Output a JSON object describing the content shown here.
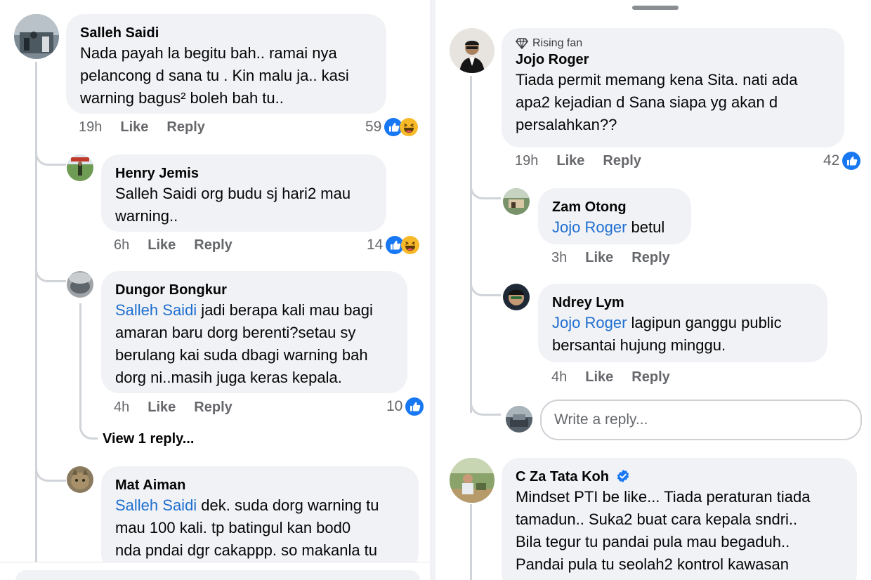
{
  "left": {
    "comments": [
      {
        "name": "Salleh Saidi",
        "lines": [
          "Nada payah la begitu bah.. ramai nya",
          "pelancong d sana tu . Kin malu ja.. kasi",
          "warning bagus² boleh bah tu.."
        ],
        "time": "19h",
        "like": "Like",
        "reply": "Reply",
        "reactions": "59",
        "reaction_icons": [
          "like-reaction-icon",
          "haha-reaction-icon"
        ]
      },
      {
        "name": "Henry Jemis",
        "lines": [
          "Salleh Saidi org budu sj hari2 mau",
          "warning.."
        ],
        "time": "6h",
        "like": "Like",
        "reply": "Reply",
        "reactions": "14",
        "reaction_icons": [
          "like-reaction-icon",
          "haha-reaction-icon"
        ]
      },
      {
        "name": "Dungor Bongkur",
        "mention": "Salleh Saidi",
        "first_rest": " jadi berapa kali mau bagi",
        "lines": [
          "amaran baru dorg berenti?setau sy",
          "berulang kai suda dbagi warning bah",
          "dorg ni..masih juga keras kepala."
        ],
        "time": "4h",
        "like": "Like",
        "reply": "Reply",
        "reactions": "10",
        "reaction_icons": [
          "like-reaction-icon"
        ],
        "view_replies": "View 1 reply..."
      },
      {
        "name": "Mat Aiman",
        "mention": "Salleh Saidi",
        "first_rest": " dek. suda dorg warning tu",
        "lines": [
          "mau 100 kali. tp batingul kan bod0",
          "nda pndai dgr cakappp. so makanla tu"
        ]
      }
    ]
  },
  "right": {
    "comments": [
      {
        "badge": "Rising fan",
        "name": "Jojo Roger",
        "lines": [
          "Tiada permit memang kena Sita. nati ada",
          "apa2 kejadian d Sana siapa yg akan d",
          "persalahkan??"
        ],
        "time": "19h",
        "like": "Like",
        "reply": "Reply",
        "reactions": "42",
        "reaction_icons": [
          "like-reaction-icon"
        ]
      },
      {
        "name": "Zam Otong",
        "mention": "Jojo Roger",
        "first_rest": " betul",
        "time": "3h",
        "like": "Like",
        "reply": "Reply"
      },
      {
        "name": "Ndrey Lym",
        "mention": "Jojo Roger",
        "first_rest": "  lagipun ganggu public",
        "lines": [
          "bersantai hujung minggu."
        ],
        "time": "4h",
        "like": "Like",
        "reply": "Reply"
      },
      {
        "name": "C Za Tata Koh",
        "verified": true,
        "lines": [
          "Mindset PTI be like... Tiada peraturan tiada",
          "tamadun.. Suka2 buat cara kepala sndri..",
          "Bila tegur tu pandai pula mau begaduh..",
          "Pandai pula tu seolah2 kontrol kawasan"
        ]
      }
    ],
    "write_reply_placeholder": "Write a reply..."
  },
  "colors": {
    "bubble": "#f0f2f5",
    "mention": "#1f6fd1",
    "meta": "#65676b",
    "like_blue": "#1877f2",
    "haha_yellow": "#f7b928"
  }
}
